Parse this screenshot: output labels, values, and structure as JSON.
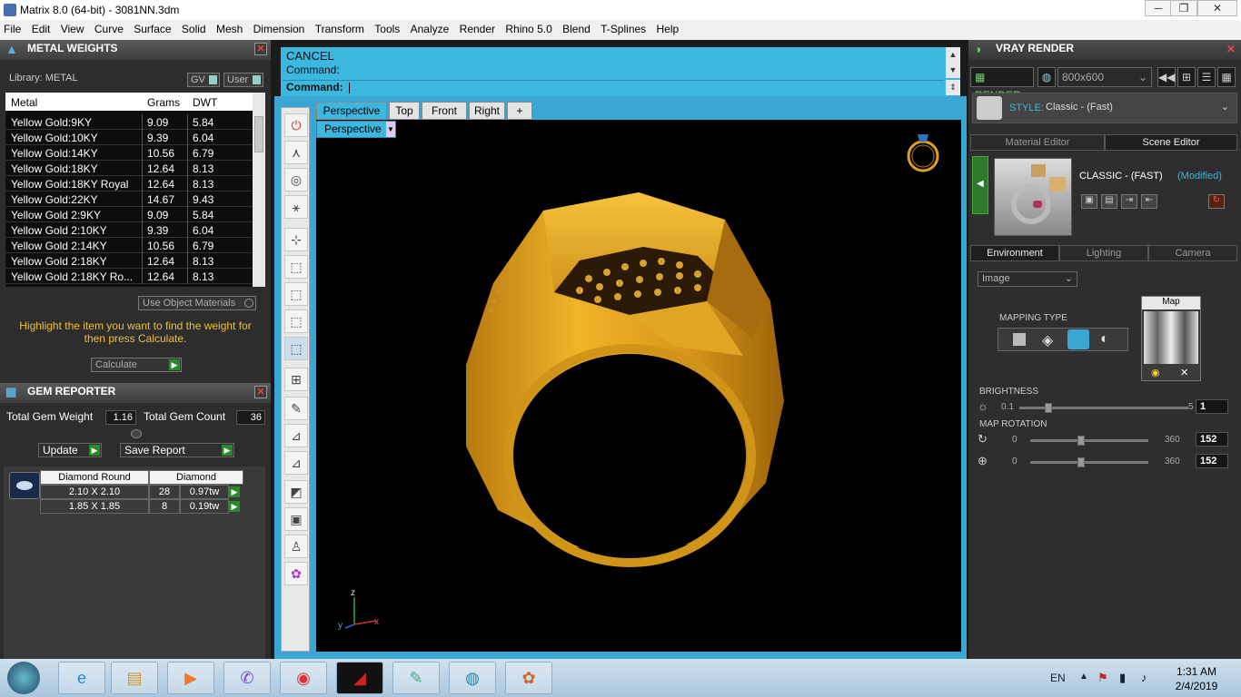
{
  "window": {
    "title": "Matrix 8.0 (64-bit) - 3081NN.3dm",
    "min": "─",
    "max": "❐",
    "close": "✕"
  },
  "menu": [
    "File",
    "Edit",
    "View",
    "Curve",
    "Surface",
    "Solid",
    "Mesh",
    "Dimension",
    "Transform",
    "Tools",
    "Analyze",
    "Render",
    "Rhino 5.0",
    "Blend",
    "T-Splines",
    "Help"
  ],
  "metal_weights": {
    "title": "METAL WEIGHTS",
    "library_label": "Library: METAL",
    "gv_label": "GV",
    "user_label": "User",
    "columns": [
      "Metal",
      "Grams",
      "DWT"
    ],
    "rows": [
      [
        "Yellow Gold:9KY",
        "9.09",
        "5.84"
      ],
      [
        "Yellow Gold:10KY",
        "9.39",
        "6.04"
      ],
      [
        "Yellow Gold:14KY",
        "10.56",
        "6.79"
      ],
      [
        "Yellow Gold:18KY",
        "12.64",
        "8.13"
      ],
      [
        "Yellow Gold:18KY Royal",
        "12.64",
        "8.13"
      ],
      [
        "Yellow Gold:22KY",
        "14.67",
        "9.43"
      ],
      [
        "Yellow Gold 2:9KY",
        "9.09",
        "5.84"
      ],
      [
        "Yellow Gold 2:10KY",
        "9.39",
        "6.04"
      ],
      [
        "Yellow Gold 2:14KY",
        "10.56",
        "6.79"
      ],
      [
        "Yellow Gold 2:18KY",
        "12.64",
        "8.13"
      ],
      [
        "Yellow Gold 2:18KY Ro...",
        "12.64",
        "8.13"
      ]
    ],
    "use_object_materials": "Use Object Materials",
    "hint": "Highlight the item you want to find the weight for then press Calculate.",
    "calculate": "Calculate"
  },
  "gem_reporter": {
    "title": "GEM REPORTER",
    "total_weight_label": "Total Gem Weight",
    "total_weight": "1.16",
    "total_count_label": "Total Gem Count",
    "total_count": "36",
    "update": "Update",
    "save_report": "Save Report",
    "table_head": [
      "Diamond Round",
      "Diamond"
    ],
    "rows": [
      [
        "2.10 X 2.10",
        "28",
        "0.97tw"
      ],
      [
        "1.85 X 1.85",
        "8",
        "0.19tw"
      ]
    ]
  },
  "command": {
    "line1": "CANCEL",
    "line2": "Command:",
    "prompt": "Command:"
  },
  "viewport": {
    "tabs": [
      "Perspective",
      "Top",
      "Front",
      "Right",
      "+"
    ],
    "active_view": "Perspective",
    "axis_z": "z",
    "axis_y": "y",
    "axis_x": "x"
  },
  "vray": {
    "title": "VRAY RENDER",
    "render": "RENDER",
    "resolution": "800x600",
    "style_label": "STYLE:",
    "style_value": "Classic - (Fast)",
    "tabs_top": [
      "Material Editor",
      "Scene Editor"
    ],
    "active_top": "Scene Editor",
    "scene_name": "CLASSIC - (FAST)",
    "scene_status": "(Modified)",
    "tabs_env": [
      "Environment",
      "Lighting",
      "Camera"
    ],
    "active_env": "Environment",
    "env_type": "Image",
    "mapping_type": "MAPPING TYPE",
    "map_label": "Map",
    "brightness_label": "BRIGHTNESS",
    "brightness_min": "0.1",
    "brightness_max": "5",
    "brightness_value": "1",
    "map_rotation_label": "MAP ROTATION",
    "rot1_min": "0",
    "rot1_max": "360",
    "rot1_value": "152",
    "rot2_min": "0",
    "rot2_max": "360",
    "rot2_value": "152"
  },
  "taskbar": {
    "lang": "EN",
    "time": "1:31 AM",
    "date": "2/4/2019"
  },
  "colors": {
    "accent": "#3cb8e0",
    "gold": "#e8a81c",
    "hint": "#f0c030"
  }
}
